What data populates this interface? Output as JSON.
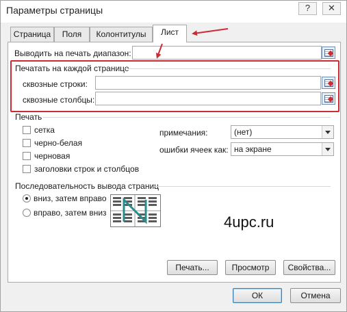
{
  "window": {
    "title": "Параметры страницы",
    "help_label": "?",
    "close_label": "✕"
  },
  "tabs": [
    {
      "label": "Страница",
      "active": false
    },
    {
      "label": "Поля",
      "active": false
    },
    {
      "label": "Колонтитулы",
      "active": false
    },
    {
      "label": "Лист",
      "active": true
    }
  ],
  "print_area": {
    "label": "Выводить на печать диапазон:",
    "value": ""
  },
  "print_titles": {
    "group_label": "Печатать на каждой странице",
    "rows_label": "сквозные строки:",
    "rows_value": "",
    "cols_label": "сквозные столбцы:",
    "cols_value": ""
  },
  "print": {
    "group_label": "Печать",
    "checkboxes": [
      {
        "label": "сетка",
        "checked": false
      },
      {
        "label": "черно-белая",
        "checked": false
      },
      {
        "label": "черновая",
        "checked": false
      },
      {
        "label": "заголовки строк и столбцов",
        "checked": false
      }
    ],
    "comments_label": "примечания:",
    "comments_value": "(нет)",
    "errors_label": "ошибки ячеек как:",
    "errors_value": "на экране"
  },
  "page_order": {
    "group_label": "Последовательность вывода страниц",
    "options": [
      {
        "label": "вниз, затем вправо",
        "selected": true
      },
      {
        "label": "вправо, затем вниз",
        "selected": false
      }
    ]
  },
  "buttons": {
    "print": "Печать...",
    "preview": "Просмотр",
    "properties": "Свойства...",
    "ok": "ОК",
    "cancel": "Отмена"
  },
  "watermark": "4upc.ru",
  "colors": {
    "annotation_red": "#cc2a35",
    "dialog_bg": "#f0f0f0"
  }
}
